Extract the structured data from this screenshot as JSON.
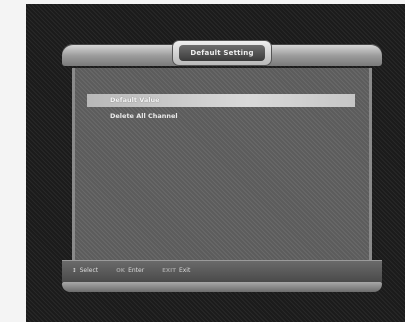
{
  "window": {
    "title": "Default Setting"
  },
  "menu": {
    "items": [
      {
        "label": "Default Value",
        "selected": true
      },
      {
        "label": "Delete All Channel",
        "selected": false
      }
    ]
  },
  "footer": {
    "hints": [
      {
        "key": "↕",
        "key_icon": "up-down-arrow-icon",
        "label": "Select"
      },
      {
        "key": "OK",
        "label": "Enter"
      },
      {
        "key": "EXIT",
        "label": "Exit"
      }
    ]
  },
  "colors": {
    "frame": "#1b1b1b",
    "content_bg": "#5c5c5c",
    "highlight": "#d0d0d0"
  }
}
